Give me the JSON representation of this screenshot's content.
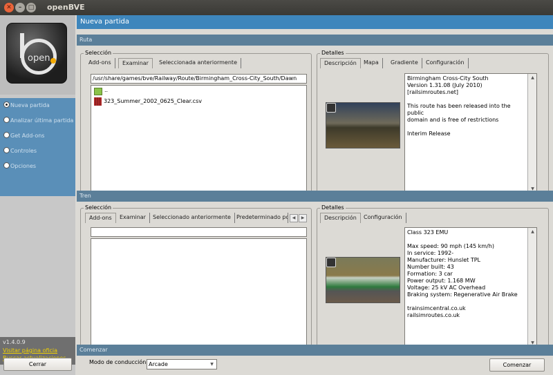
{
  "window": {
    "title": "openBVE"
  },
  "sidebar": {
    "logo_text": "open",
    "menu": [
      {
        "label": "Nueva partida",
        "selected": true
      },
      {
        "label": "Analizar última partida",
        "selected": false
      },
      {
        "label": "Get Add-ons",
        "selected": false
      },
      {
        "label": "Controles",
        "selected": false
      },
      {
        "label": "Opciones",
        "selected": false
      }
    ],
    "version": "v1.4.0.9",
    "link_visit": "Visitar página oficia",
    "link_update": "Buscar actualizaciones",
    "close_label": "Cerrar"
  },
  "main": {
    "title": "Nueva partida",
    "route": {
      "section": "Ruta",
      "selection": {
        "label": "Selección",
        "tabs": [
          "Add-ons",
          "Examinar",
          "Seleccionada anteriormente"
        ],
        "active_tab": 1,
        "path": "/usr/share/games/bve/Railway/Route/Birmingham_Cross-City_South/Dawn",
        "up_entry": "..",
        "file": "323_Summer_2002_0625_Clear.csv"
      },
      "details": {
        "label": "Detalles",
        "tabs": [
          "Descripción",
          "Mapa",
          "Gradiente",
          "Configuración"
        ],
        "active_tab": 0,
        "lines": [
          "Birmingham Cross-City South",
          "Version 1.31.08 (July 2010)",
          "[railsimroutes.net]",
          "",
          "This route has been released into the public",
          "domain and is free of restrictions",
          "",
          "Interim Release"
        ]
      }
    },
    "train": {
      "section": "Tren",
      "selection": {
        "label": "Selección",
        "tabs": [
          "Add-ons",
          "Examinar",
          "Seleccionado anteriormente",
          "Predeterminado po"
        ],
        "active_tab": 0,
        "path": ""
      },
      "details": {
        "label": "Detalles",
        "tabs": [
          "Descripción",
          "Configuración"
        ],
        "active_tab": 0,
        "lines": [
          "Class 323 EMU",
          "",
          "Max speed: 90 mph (145 km/h)",
          "In service: 1992-",
          "Manufacturer: Hunslet TPL",
          "Number built: 43",
          "Formation: 3 car",
          "Power output: 1.168 MW",
          "Voltage: 25 kV AC Overhead",
          "Braking system: Regenerative Air Brake",
          "",
          "trainsimcentral.co.uk",
          "railsimroutes.co.uk"
        ]
      }
    },
    "start": {
      "section": "Comenzar",
      "mode_label": "Modo de conducción",
      "mode_value": "Arcade",
      "start_label": "Comenzar"
    }
  },
  "colors": {
    "accent": "#3e86bc",
    "menu": "#5a8fb8",
    "section": "#5b7f99",
    "link": "#f2d200"
  }
}
